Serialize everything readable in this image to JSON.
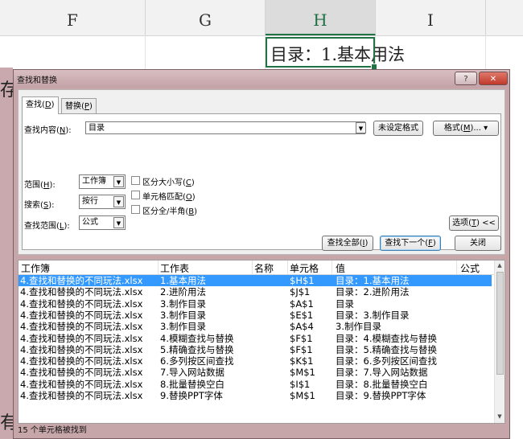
{
  "sheet": {
    "columns": [
      "F",
      "G",
      "H",
      "I"
    ],
    "active_column": "H",
    "cell_text": "目录：1.基本用法",
    "left_chars": [
      "存",
      "有"
    ]
  },
  "dialog": {
    "title": "查找和替换",
    "help_label": "?",
    "close_label": "✕",
    "tabs": [
      {
        "text": "查找",
        "key": "D",
        "active": true
      },
      {
        "text": "替换",
        "key": "P",
        "active": false
      }
    ],
    "find_label": "查找内容",
    "find_key": "N",
    "find_value": "目录",
    "format_status": "未设定格式",
    "format_button": "格式",
    "format_key": "M",
    "scope_label": "范围",
    "scope_key": "H",
    "scope_value": "工作簿",
    "search_label": "搜索",
    "search_key": "S",
    "search_value": "按行",
    "lookin_label": "查找范围",
    "lookin_key": "L",
    "lookin_value": "公式",
    "match_case": "区分大小写",
    "match_case_key": "C",
    "match_cell": "单元格匹配",
    "match_cell_key": "O",
    "match_width": "区分全/半角",
    "match_width_key": "B",
    "options_button": "选项",
    "options_key": "T",
    "find_all": "查找全部",
    "find_all_key": "I",
    "find_next": "查找下一个",
    "find_next_key": "F",
    "close_button": "关闭"
  },
  "results": {
    "columns": [
      "工作簿",
      "工作表",
      "名称",
      "单元格",
      "值",
      "公式"
    ],
    "rows": [
      {
        "book": "4.查找和替换的不同玩法.xlsx",
        "sheet": "1.基本用法",
        "name": "",
        "cell": "$H$1",
        "value": "目录：1.基本用法",
        "formula": "",
        "selected": true
      },
      {
        "book": "4.查找和替换的不同玩法.xlsx",
        "sheet": "2.进阶用法",
        "name": "",
        "cell": "$J$1",
        "value": "目录：2.进阶用法",
        "formula": "",
        "selected": false
      },
      {
        "book": "4.查找和替换的不同玩法.xlsx",
        "sheet": "3.制作目录",
        "name": "",
        "cell": "$A$1",
        "value": "目录",
        "formula": "",
        "selected": false
      },
      {
        "book": "4.查找和替换的不同玩法.xlsx",
        "sheet": "3.制作目录",
        "name": "",
        "cell": "$E$1",
        "value": "目录：3.制作目录",
        "formula": "",
        "selected": false
      },
      {
        "book": "4.查找和替换的不同玩法.xlsx",
        "sheet": "3.制作目录",
        "name": "",
        "cell": "$A$4",
        "value": "3.制作目录",
        "formula": "",
        "selected": false
      },
      {
        "book": "4.查找和替换的不同玩法.xlsx",
        "sheet": "4.模糊查找与替换",
        "name": "",
        "cell": "$F$1",
        "value": "目录：4.模糊查找与替换",
        "formula": "",
        "selected": false
      },
      {
        "book": "4.查找和替换的不同玩法.xlsx",
        "sheet": "5.精确查找与替换",
        "name": "",
        "cell": "$F$1",
        "value": "目录：5.精确查找与替换",
        "formula": "",
        "selected": false
      },
      {
        "book": "4.查找和替换的不同玩法.xlsx",
        "sheet": "6.多列按区间查找",
        "name": "",
        "cell": "$K$1",
        "value": "目录：6.多列按区间查找",
        "formula": "",
        "selected": false
      },
      {
        "book": "4.查找和替换的不同玩法.xlsx",
        "sheet": "7.导入网站数据",
        "name": "",
        "cell": "$M$1",
        "value": "目录：7.导入网站数据",
        "formula": "",
        "selected": false
      },
      {
        "book": "4.查找和替换的不同玩法.xlsx",
        "sheet": "8.批量替换空白",
        "name": "",
        "cell": "$I$1",
        "value": "目录：8.批量替换空白",
        "formula": "",
        "selected": false
      },
      {
        "book": "4.查找和替换的不同玩法.xlsx",
        "sheet": "9.替换PPT字体",
        "name": "",
        "cell": "$M$1",
        "value": "目录：9.替换PPT字体",
        "formula": "",
        "selected": false
      }
    ],
    "status": "15 个单元格被找到"
  },
  "colors": {
    "dialog_frame": "#c7a6aa",
    "selection": "#3399ff",
    "excel_green": "#217346"
  }
}
